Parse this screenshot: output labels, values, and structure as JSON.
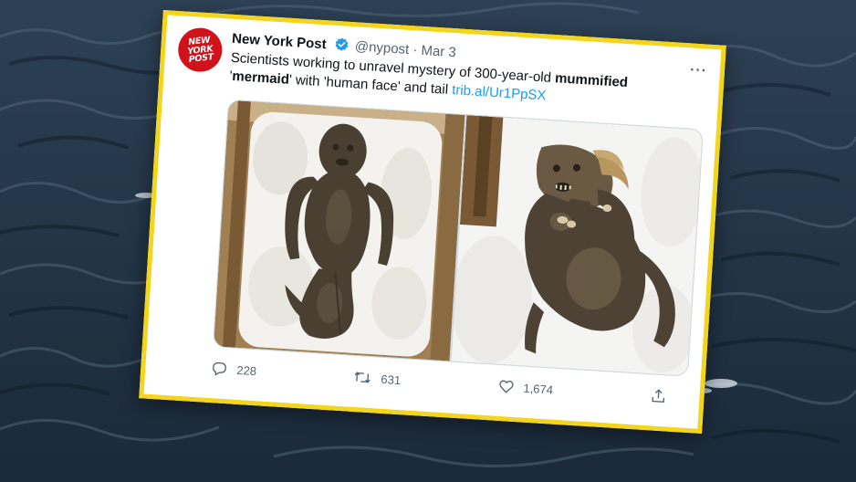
{
  "tweet": {
    "author_name": "New York Post",
    "avatar_text": "NEW\nYORK\nPOST",
    "handle": "@nypost",
    "separator": "·",
    "date": "Mar 3",
    "text_part1": "Scientists working to unravel mystery of 300-year-old ",
    "text_bold1": "mummified",
    "text_part2": "'",
    "text_bold2": "mermaid",
    "text_part3": "' with 'human face' and tail ",
    "link": "trib.al/Ur1PpSX",
    "more": "···"
  },
  "actions": {
    "replies": "228",
    "retweets": "631",
    "likes": "1,674"
  },
  "colors": {
    "frame": "#f2d51c",
    "brand_red": "#d0121a",
    "link": "#1d9bf0",
    "verified": "#1d9bf0",
    "muted": "#536471"
  },
  "icons": [
    "verified-badge-icon",
    "more-options-icon",
    "reply-icon",
    "retweet-icon",
    "like-icon",
    "share-icon"
  ]
}
